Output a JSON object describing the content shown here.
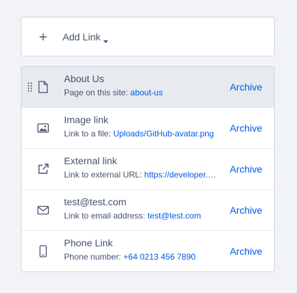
{
  "toolbar": {
    "add_link_label": "Add Link"
  },
  "links": [
    {
      "title": "About Us",
      "desc_label": "Page on this site:",
      "desc_value": "about-us",
      "icon": "page-icon",
      "archive_label": "Archive",
      "active": true
    },
    {
      "title": "Image link",
      "desc_label": "Link to a file:",
      "desc_value": "Uploads/GitHub-avatar.png",
      "icon": "image-icon",
      "archive_label": "Archive",
      "active": false
    },
    {
      "title": "External link",
      "desc_label": "Link to external URL:",
      "desc_value": "https://developer.example",
      "icon": "external-link-icon",
      "archive_label": "Archive",
      "active": false
    },
    {
      "title": "test@test.com",
      "desc_label": "Link to email address:",
      "desc_value": "test@test.com",
      "icon": "email-icon",
      "archive_label": "Archive",
      "active": false
    },
    {
      "title": "Phone Link",
      "desc_label": "Phone number:",
      "desc_value": "+64 0213 456 7890",
      "icon": "phone-icon",
      "archive_label": "Archive",
      "active": false
    }
  ],
  "colors": {
    "text": "#43536d",
    "link": "#005ae0",
    "active_row": "#e7ebf0",
    "border": "#ced5e1"
  }
}
